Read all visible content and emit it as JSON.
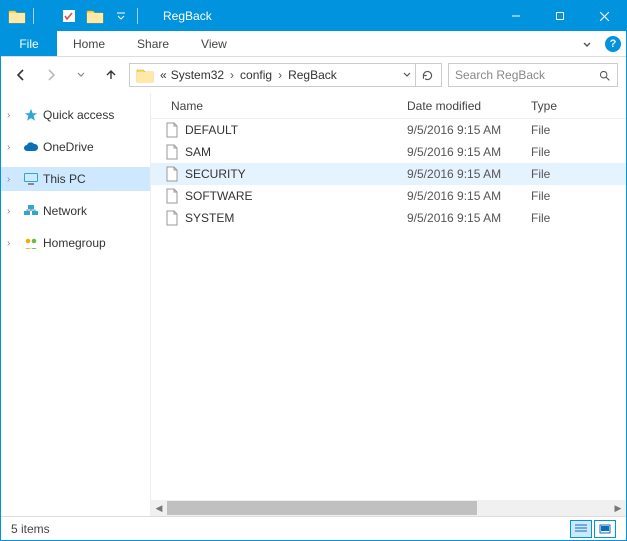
{
  "window": {
    "title": "RegBack"
  },
  "ribbon": {
    "file": "File",
    "tabs": [
      "Home",
      "Share",
      "View"
    ]
  },
  "breadcrumb": {
    "prefix": "«",
    "segments": [
      "System32",
      "config",
      "RegBack"
    ]
  },
  "search": {
    "placeholder": "Search RegBack"
  },
  "tree": {
    "items": [
      {
        "label": "Quick access",
        "icon": "star",
        "color": "#2fa7d6"
      },
      {
        "label": "OneDrive",
        "icon": "cloud",
        "color": "#0a6fb8"
      },
      {
        "label": "This PC",
        "icon": "monitor",
        "color": "#2fa7d6",
        "selected": true
      },
      {
        "label": "Network",
        "icon": "network",
        "color": "#2fa7d6"
      },
      {
        "label": "Homegroup",
        "icon": "homegroup",
        "color": "#f0b000"
      }
    ]
  },
  "columns": {
    "name": "Name",
    "date": "Date modified",
    "type": "Type"
  },
  "files": [
    {
      "name": "DEFAULT",
      "date": "9/5/2016 9:15 AM",
      "type": "File",
      "selected": false
    },
    {
      "name": "SAM",
      "date": "9/5/2016 9:15 AM",
      "type": "File",
      "selected": false
    },
    {
      "name": "SECURITY",
      "date": "9/5/2016 9:15 AM",
      "type": "File",
      "selected": true
    },
    {
      "name": "SOFTWARE",
      "date": "9/5/2016 9:15 AM",
      "type": "File",
      "selected": false
    },
    {
      "name": "SYSTEM",
      "date": "9/5/2016 9:15 AM",
      "type": "File",
      "selected": false
    }
  ],
  "status": {
    "count": "5 items"
  }
}
